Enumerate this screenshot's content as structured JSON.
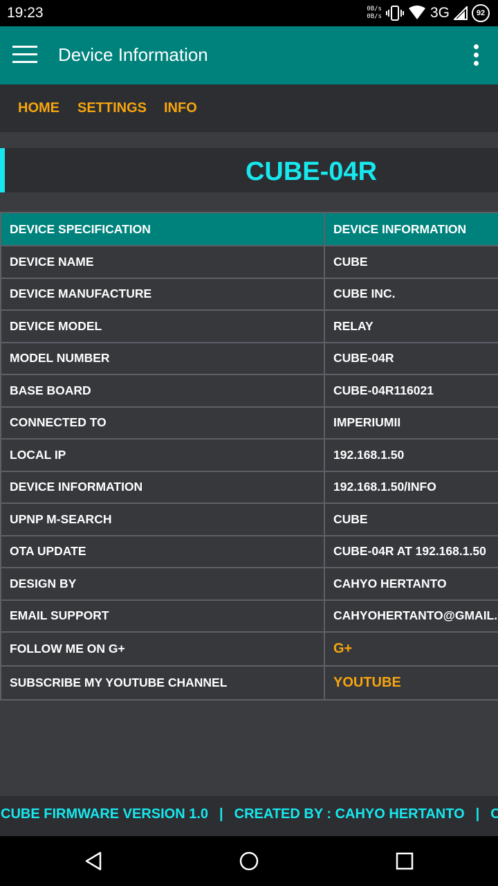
{
  "status_bar": {
    "time": "19:23",
    "net_speed_up": "0B/s",
    "net_speed_down": "0B/s",
    "network": "3G",
    "battery": "92"
  },
  "app_bar": {
    "title": "Device Information"
  },
  "nav": {
    "home": "HOME",
    "settings": "SETTINGS",
    "info": "INFO"
  },
  "device_title": "CUBE-04R",
  "table": {
    "headers": [
      "DEVICE SPECIFICATION",
      "DEVICE INFORMATION"
    ],
    "rows": [
      {
        "label": "DEVICE NAME",
        "value": "CUBE"
      },
      {
        "label": "DEVICE MANUFACTURE",
        "value": "CUBE INC."
      },
      {
        "label": "DEVICE MODEL",
        "value": "RELAY"
      },
      {
        "label": "MODEL NUMBER",
        "value": "CUBE-04R"
      },
      {
        "label": "BASE BOARD",
        "value": "CUBE-04R116021"
      },
      {
        "label": "CONNECTED TO",
        "value": "IMPERIUMII"
      },
      {
        "label": "LOCAL IP",
        "value": "192.168.1.50"
      },
      {
        "label": "DEVICE INFORMATION",
        "value": "192.168.1.50/INFO"
      },
      {
        "label": "UPNP M-SEARCH",
        "value": "CUBE"
      },
      {
        "label": "OTA UPDATE",
        "value": "CUBE-04R AT 192.168.1.50"
      },
      {
        "label": "DESIGN BY",
        "value": "CAHYO HERTANTO"
      },
      {
        "label": "EMAIL SUPPORT",
        "value": "CAHYOHERTANTO@GMAIL.C"
      }
    ],
    "link_rows": [
      {
        "label": "FOLLOW ME ON G+",
        "value": "G+"
      },
      {
        "label": "SUBSCRIBE MY YOUTUBE CHANNEL",
        "value": "YOUTUBE"
      }
    ]
  },
  "footer": {
    "firmware": "CUBE FIRMWARE VERSION 1.0",
    "separator": "|",
    "created_by": "CREATED BY : CAHYO HERTANTO",
    "trailing": "CO"
  },
  "colors": {
    "teal": "#00827c",
    "cyan": "#17e8ee",
    "orange": "#f7a50f",
    "background": "#3a3c40"
  }
}
